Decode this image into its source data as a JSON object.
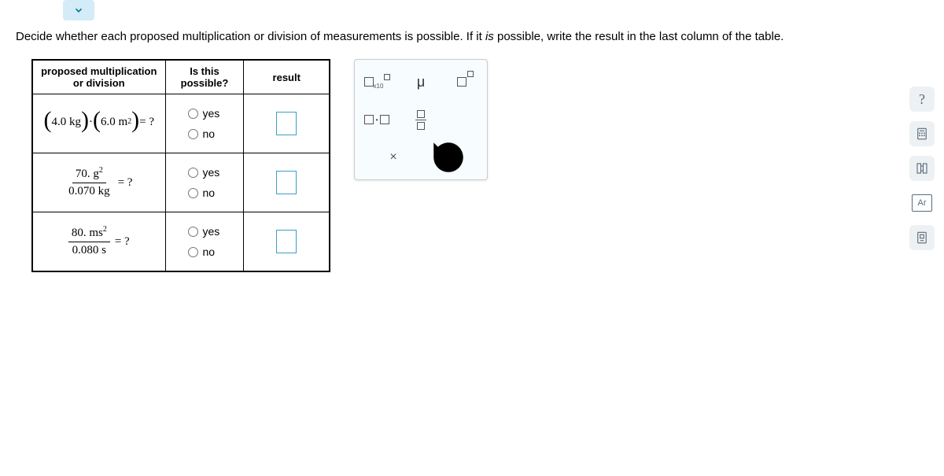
{
  "question": "Decide whether each proposed multiplication or division of measurements is possible. If it is possible, write the result in the last column of the table.",
  "table": {
    "headers": {
      "proposed": "proposed multiplication or division",
      "possible": "Is this possible?",
      "result": "result"
    },
    "options": {
      "yes": "yes",
      "no": "no"
    },
    "rows": [
      {
        "expr": {
          "a": "4.0 kg",
          "b": "6.0 m",
          "b_exp": "2",
          "suffix": " = ?"
        }
      },
      {
        "expr": {
          "num_val": "70. g",
          "num_exp": "2",
          "den": "0.070 kg",
          "suffix": " = ?"
        }
      },
      {
        "expr": {
          "num_val": "80. ms",
          "num_exp": "2",
          "den": "0.080 s",
          "suffix": " = ?"
        }
      }
    ]
  },
  "keypad": {
    "x10": "x10",
    "mu": "μ",
    "times": "×"
  },
  "sidebar": {
    "help": "?",
    "ar": "Ar"
  },
  "italic_is": "is"
}
